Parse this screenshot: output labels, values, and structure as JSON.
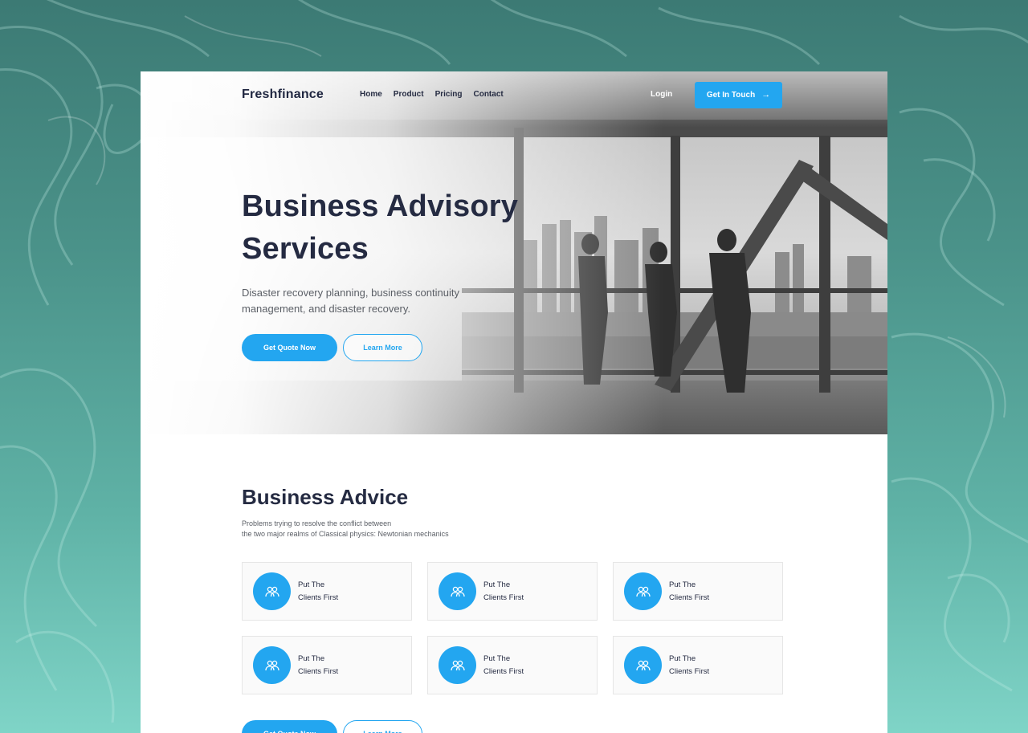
{
  "brand": {
    "logo": "Freshfinance"
  },
  "nav": {
    "links": [
      "Home",
      "Product",
      "Pricing",
      "Contact"
    ],
    "login": "Login",
    "cta": "Get In Touch"
  },
  "hero": {
    "title": "Business Advisory Services",
    "description": "Disaster recovery planning, business continuity management, and disaster recovery.",
    "primary_button": "Get Quote Now",
    "secondary_button": "Learn More"
  },
  "advice": {
    "title": "Business Advice",
    "description_line1": "Problems trying to resolve the conflict between",
    "description_line2": "the two major realms of Classical physics: Newtonian mechanics",
    "cards": [
      {
        "line1": "Put The",
        "line2": "Clients First",
        "icon": "users-icon"
      },
      {
        "line1": "Put The",
        "line2": "Clients First",
        "icon": "users-icon"
      },
      {
        "line1": "Put The",
        "line2": "Clients First",
        "icon": "users-icon"
      },
      {
        "line1": "Put The",
        "line2": "Clients First",
        "icon": "users-icon"
      },
      {
        "line1": "Put The",
        "line2": "Clients First",
        "icon": "users-icon"
      },
      {
        "line1": "Put The",
        "line2": "Clients First",
        "icon": "users-icon"
      }
    ],
    "primary_button": "Get Quote Now",
    "secondary_button": "Learn More"
  },
  "colors": {
    "accent": "#23a6f0",
    "heading": "#252b42",
    "body_text": "#5b5f66",
    "backdrop": "#4b938a"
  }
}
